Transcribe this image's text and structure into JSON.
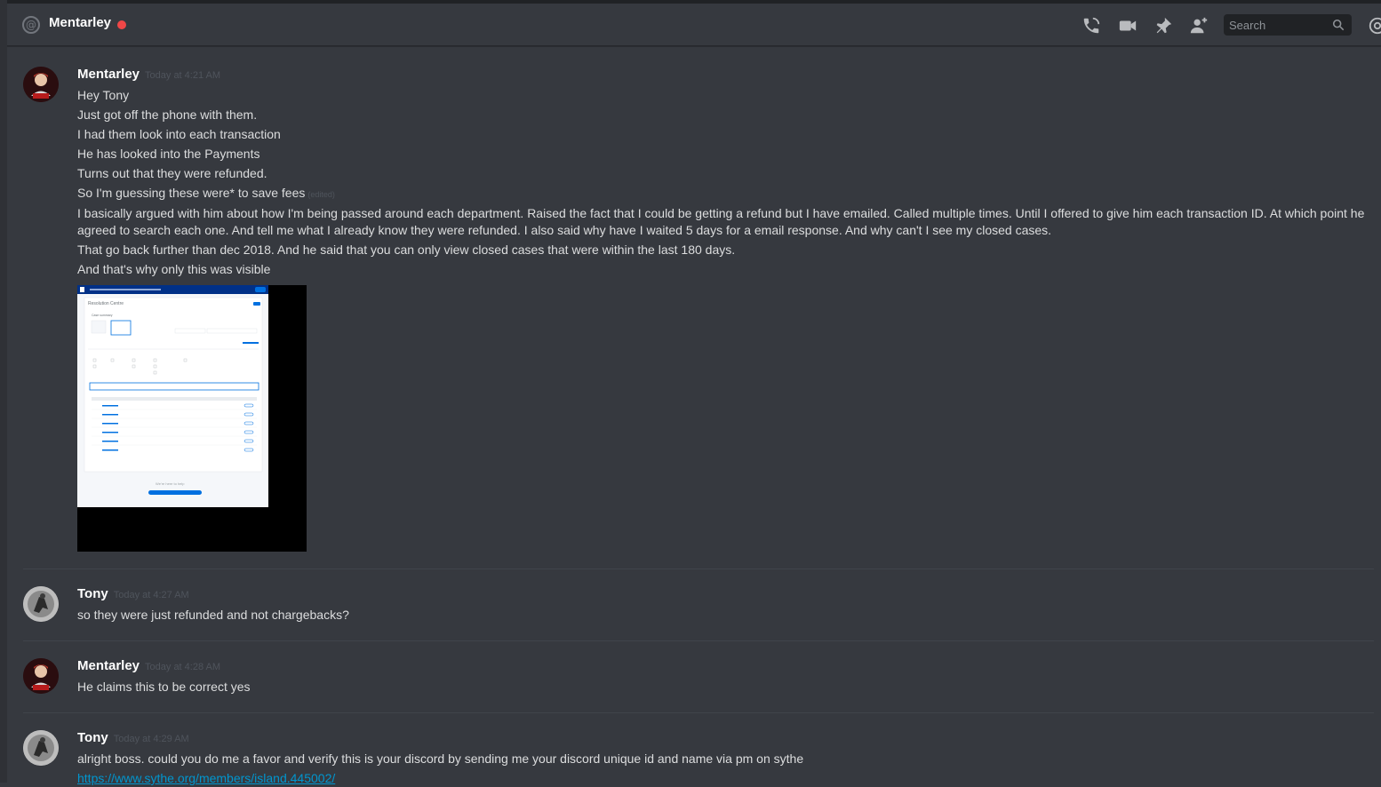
{
  "header": {
    "channel_name": "Mentarley",
    "status_color": "#f04747",
    "icons": [
      "at-icon",
      "call-icon",
      "video-icon",
      "pin-icon",
      "add-friend-icon",
      "mention-icon"
    ],
    "search": {
      "placeholder": "Search"
    }
  },
  "messages": [
    {
      "author": "Mentarley",
      "timestamp": "Today at 4:21 AM",
      "lines": [
        "Hey Tony",
        "Just got off the phone with them.",
        "I had them look into each transaction",
        "He has looked into the Payments",
        "Turns out that they were refunded.",
        "So I'm guessing these were* to save fees"
      ],
      "edited_label": "(edited)",
      "long_text": "I basically argued with him about how I'm being passed around each department. Raised the fact that I could be getting a refund but I have emailed. Called multiple times. Until I offered to give him each transaction ID. At which point he agreed to search each one. And tell me what I already know they were refunded. I also said why have I waited 5 days for a email response. And why can't I see my closed cases.",
      "lines_after": [
        "That go back further than dec 2018. And he said that you can only view closed cases that were within the last 180 days.",
        "And that's why only this was visible"
      ],
      "attachment": {
        "title": "Resolution Centre",
        "summary_label": "Case summary",
        "footer_text": "We're here to help"
      }
    },
    {
      "author": "Tony",
      "timestamp": "Today at 4:27 AM",
      "text": "so they were just refunded and not chargebacks?"
    },
    {
      "author": "Mentarley",
      "timestamp": "Today at 4:28 AM",
      "text": "He claims this to be correct yes"
    },
    {
      "author": "Tony",
      "timestamp": "Today at 4:29 AM",
      "text": "alright boss. could you do me a favor and verify this is your discord by sending me your discord unique id and name via pm on sythe",
      "link": "https://www.sythe.org/members/island.445002/"
    }
  ]
}
